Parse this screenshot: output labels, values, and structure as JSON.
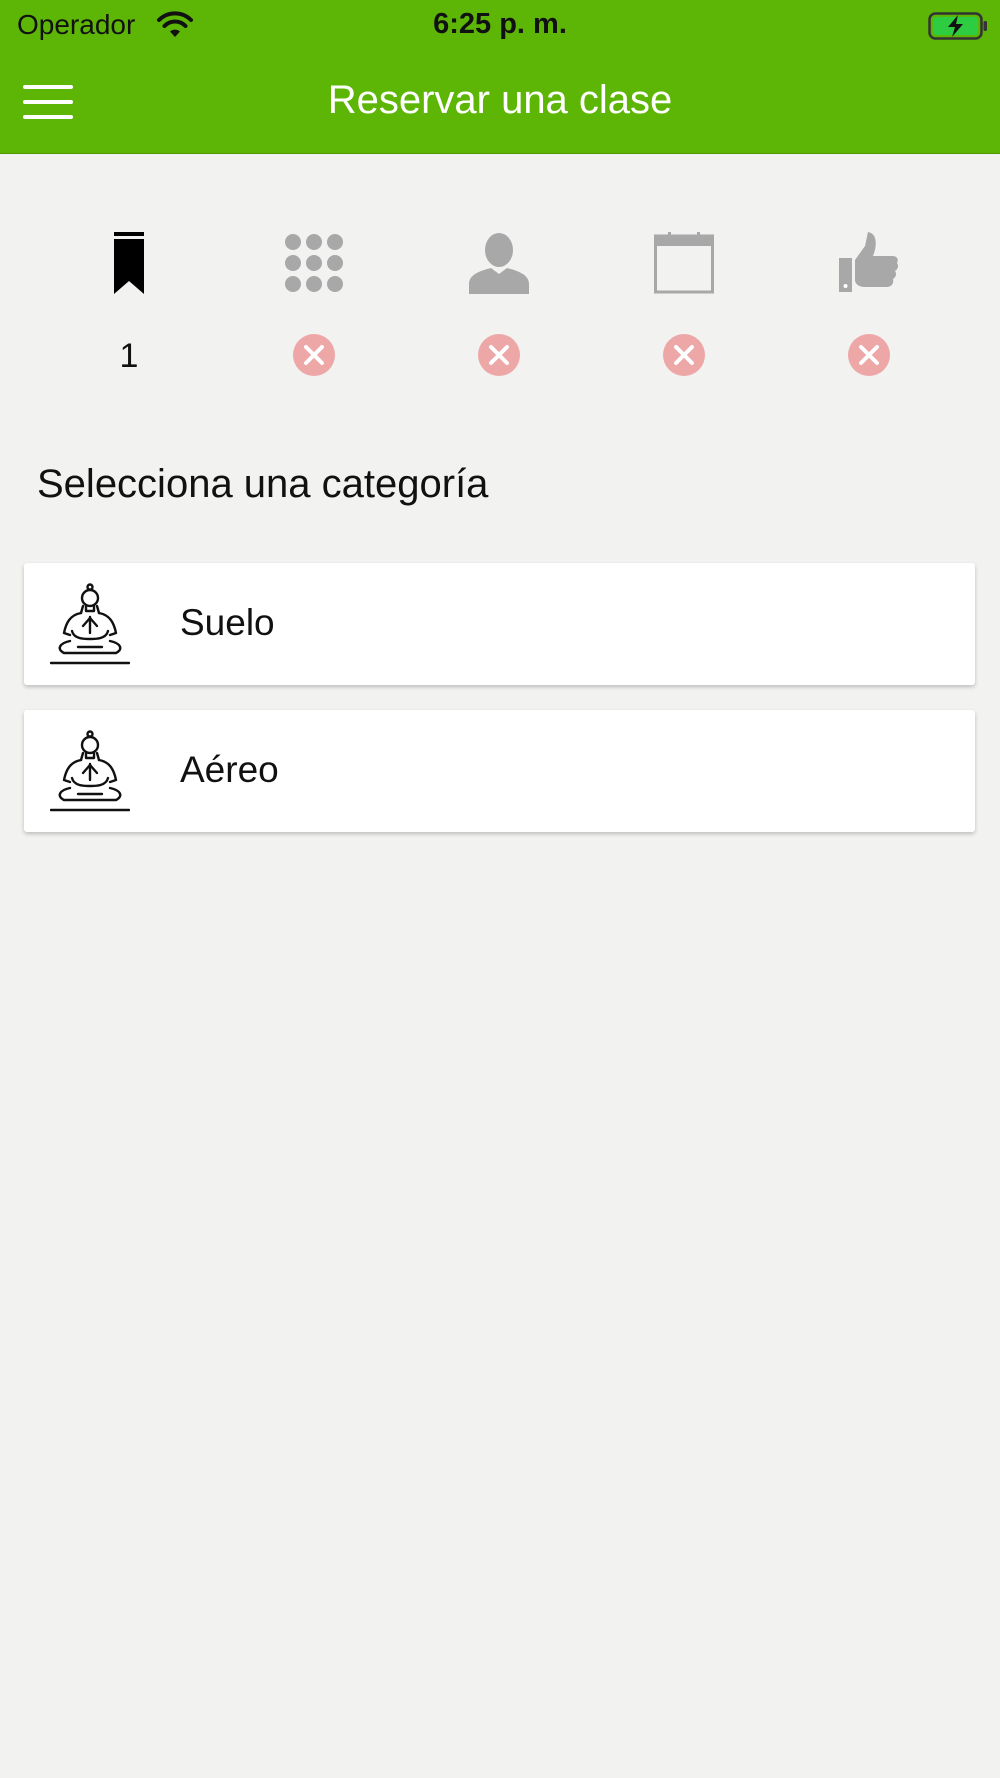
{
  "status_bar": {
    "carrier": "Operador",
    "time": "6:25 p. m.",
    "wifi_icon": "wifi-icon",
    "battery_icon": "battery-charging-icon"
  },
  "header": {
    "title": "Reservar una clase",
    "menu_icon": "hamburger-menu-icon",
    "background_color": "#5db606"
  },
  "steps": [
    {
      "icon": "bookmark-icon",
      "state": "active",
      "label": "1"
    },
    {
      "icon": "grid-dots-icon",
      "state": "incomplete",
      "label": ""
    },
    {
      "icon": "person-icon",
      "state": "incomplete",
      "label": ""
    },
    {
      "icon": "calendar-icon",
      "state": "incomplete",
      "label": ""
    },
    {
      "icon": "thumbs-up-icon",
      "state": "incomplete",
      "label": ""
    }
  ],
  "section_title": "Selecciona una categoría",
  "categories": [
    {
      "label": "Suelo",
      "icon": "meditation-figure-icon"
    },
    {
      "label": "Aéreo",
      "icon": "meditation-figure-icon"
    }
  ],
  "colors": {
    "active_step": "#000000",
    "inactive_step": "#a8a8a8",
    "incomplete_badge": "#eda7a7",
    "background": "#f2f2f1"
  }
}
